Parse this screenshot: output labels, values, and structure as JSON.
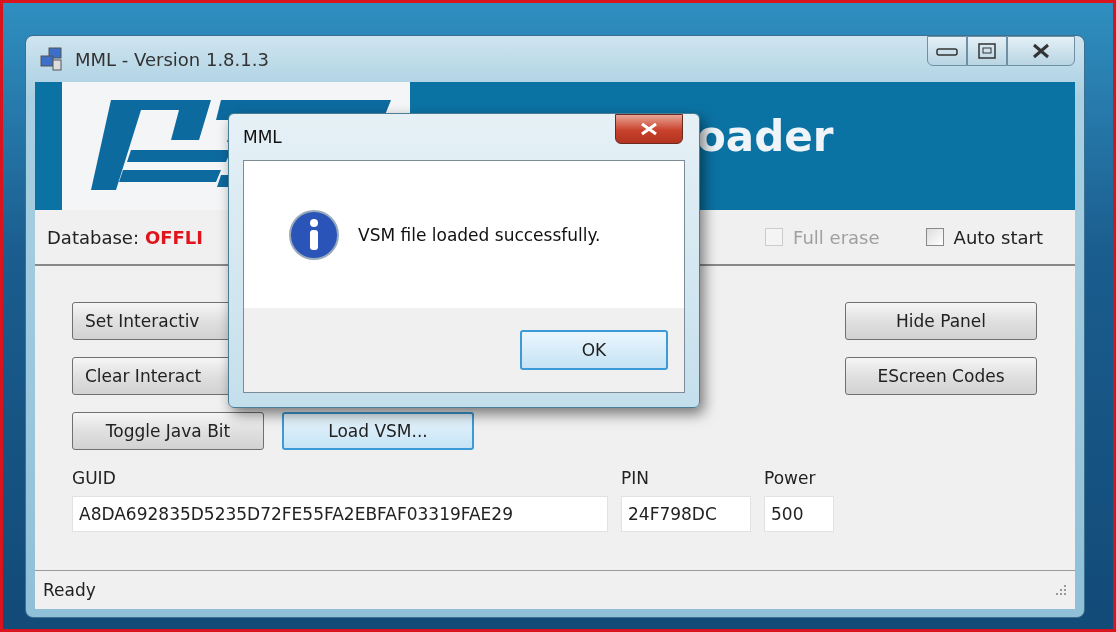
{
  "window": {
    "title": "MML - Version 1.8.1.3"
  },
  "banner": {
    "title": "oader"
  },
  "database": {
    "label": "Database:",
    "status": "OFFLI"
  },
  "options": [
    {
      "label": "Full erase",
      "checked": false,
      "disabled": true
    },
    {
      "label": "Auto start",
      "checked": false,
      "disabled": false
    }
  ],
  "left_buttons": [
    {
      "label": "Set Interactiv",
      "focused": false
    },
    {
      "label": "Clear Interact",
      "focused": false
    },
    {
      "label": "Toggle Java Bit",
      "focused": false
    },
    {
      "label": "Load VSM...",
      "focused": true
    }
  ],
  "right_buttons": [
    {
      "label": "Hide Panel"
    },
    {
      "label": "EScreen Codes"
    }
  ],
  "fields": [
    {
      "label": "GUID",
      "value": "A8DA692835D5235D72FE55FA2EBFAF03319FAE29"
    },
    {
      "label": "PIN",
      "value": "24F798DC"
    },
    {
      "label": "Power",
      "value": "500"
    }
  ],
  "status_bar": {
    "text": "Ready"
  },
  "dialog": {
    "title": "MML",
    "message": "VSM file loaded successfully.",
    "button": "OK"
  }
}
